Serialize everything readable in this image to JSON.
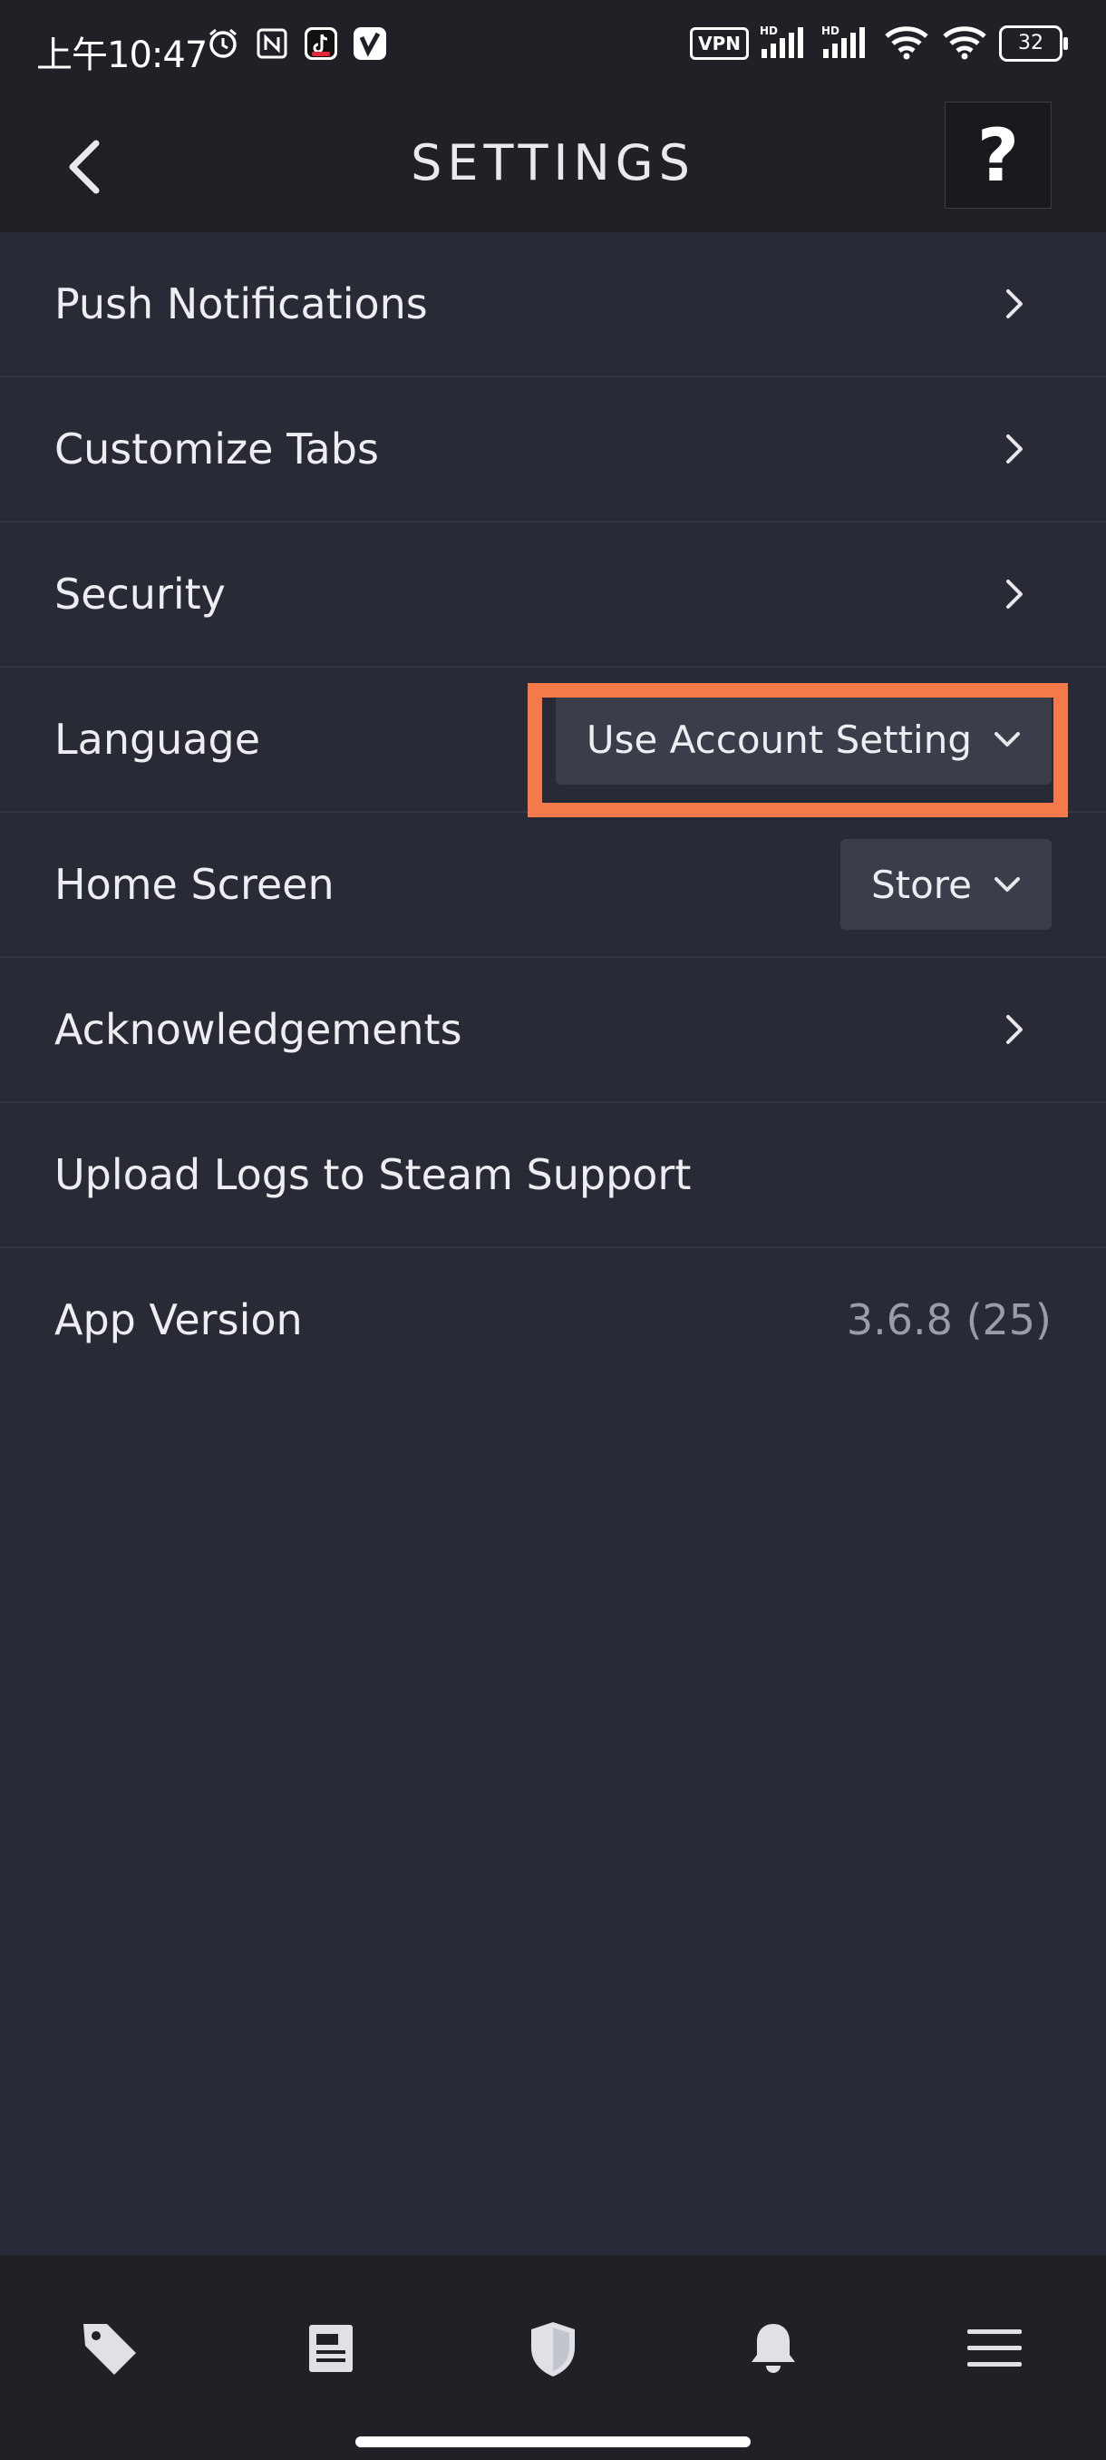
{
  "status_bar": {
    "time": "上午10:47",
    "vpn": "VPN",
    "hd1": "HD",
    "hd2": "HD",
    "battery": "32"
  },
  "header": {
    "title": "SETTINGS",
    "help": "?"
  },
  "settings": {
    "push_notifications": "Push Notifications",
    "customize_tabs": "Customize Tabs",
    "security": "Security",
    "language": {
      "label": "Language",
      "value": "Use Account Setting"
    },
    "home_screen": {
      "label": "Home Screen",
      "value": "Store"
    },
    "acknowledgements": "Acknowledgements",
    "upload_logs": "Upload Logs to Steam Support",
    "app_version": {
      "label": "App Version",
      "value": "3.6.8 (25)"
    }
  },
  "bottom_nav": {
    "items": [
      "store-tag-icon",
      "news-icon",
      "guard-shield-icon",
      "notifications-bell-icon",
      "menu-icon"
    ]
  },
  "colors": {
    "background": "#282b35",
    "header": "#1f2126",
    "highlight": "#f47a4b",
    "dropdown": "#3a3d4a"
  }
}
